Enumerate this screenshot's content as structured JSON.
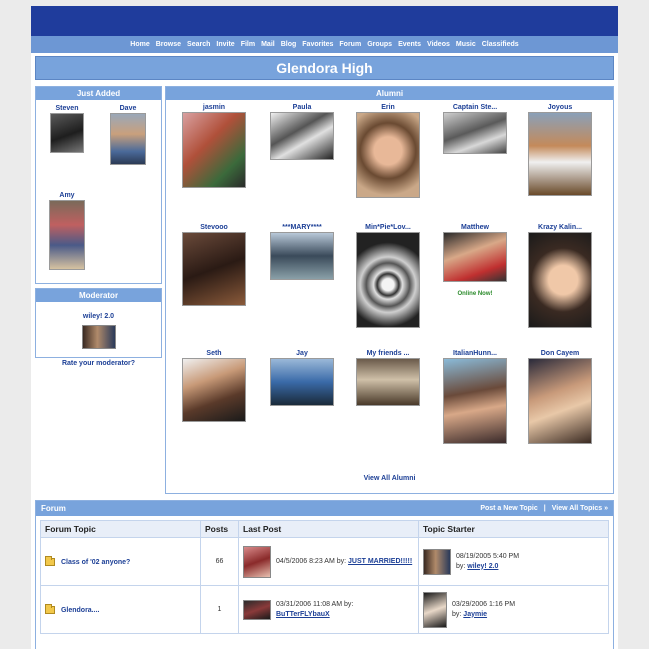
{
  "nav": [
    "Home",
    "Browse",
    "Search",
    "Invite",
    "Film",
    "Mail",
    "Blog",
    "Favorites",
    "Forum",
    "Groups",
    "Events",
    "Videos",
    "Music",
    "Classifieds"
  ],
  "school_title": "Glendora High",
  "just_added": {
    "heading": "Just Added",
    "members": [
      "Steven",
      "Dave",
      "Amy"
    ]
  },
  "moderator": {
    "heading": "Moderator",
    "name": "wiley! 2.0",
    "rate_link": "Rate your moderator?"
  },
  "alumni": {
    "heading": "Alumni",
    "members": [
      "jasmin",
      "Paula",
      "Erin",
      "Captain Ste...",
      "Joyous",
      "Stevooo",
      "***MARY****",
      "Min*Pie*Lov...",
      "Matthew",
      "Krazy Kalin...",
      "Seth",
      "Jay",
      "My friends ...",
      "ItalianHunn...",
      "Don Cayem"
    ],
    "online_text": "Online Now!",
    "view_all": "View All Alumni"
  },
  "forum": {
    "heading": "Forum",
    "post_new": "Post a New Topic",
    "separator": "|",
    "view_all_topics": "View All Topics »",
    "columns": [
      "Forum Topic",
      "Posts",
      "Last Post",
      "Topic Starter"
    ],
    "rows": [
      {
        "topic": "Class of '02 anyone?",
        "posts": "66",
        "last_post_date": "04/5/2006 8:23 AM by:",
        "last_post_by": "JUST MARRIED!!!!!",
        "starter_date": "08/19/2005 5:40 PM",
        "starter_by_label": "by:",
        "starter_by": "wiley! 2.0"
      },
      {
        "topic": "Glendora....",
        "posts": "1",
        "last_post_date": "03/31/2006 11:08 AM by:",
        "last_post_by": "BuTTerFLYbauX",
        "starter_date": "03/29/2006 1:16 PM",
        "starter_by_label": "by:",
        "starter_by": "Jaymie"
      }
    ]
  }
}
